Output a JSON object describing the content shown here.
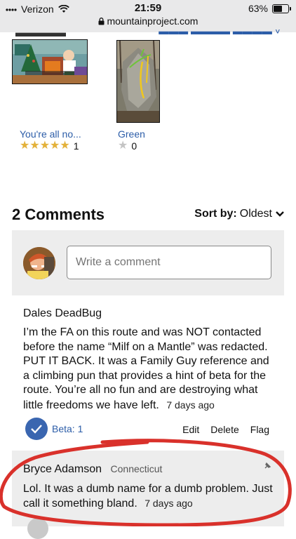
{
  "status_bar": {
    "carrier": "Verizon",
    "time": "21:59",
    "battery": "63%",
    "battery_level": 0.63,
    "url": "mountainproject.com"
  },
  "photos_section": {
    "photos": [
      {
        "caption": "You're all no...",
        "rating_count": "1",
        "stars": 5
      },
      {
        "caption": "Green",
        "rating_count": "0",
        "stars": 0
      }
    ]
  },
  "comments": {
    "title": "2 Comments",
    "sort_label": "Sort by:",
    "sort_value": "Oldest",
    "write_placeholder": "Write a comment",
    "items": [
      {
        "author": "Dales DeadBug",
        "text": "I’m the FA on this route and was NOT contacted before the name “Milf on a Mantle” was redacted. PUT IT BACK. It was a Family Guy reference and a climbing pun that provides a hint of beta for the route. You’re all no fun and are destroying what little freedoms we have left.",
        "timestamp": "7 days ago",
        "beta_label": "Beta: 1",
        "actions": [
          "Edit",
          "Delete",
          "Flag"
        ]
      },
      {
        "author": "Bryce Adamson",
        "location": "Connecticut",
        "text": "Lol. It was a dumb name for a dumb problem. Just call it something bland.",
        "timestamp": "7 days ago"
      }
    ]
  },
  "colors": {
    "link": "#2c5da8",
    "star": "#e3b13a",
    "annotation": "#d9312b"
  },
  "icons": [
    "signal-icon",
    "wifi-icon",
    "lock-icon",
    "battery-icon",
    "chevron-down-icon",
    "check-icon",
    "pin-icon",
    "star-icon"
  ]
}
